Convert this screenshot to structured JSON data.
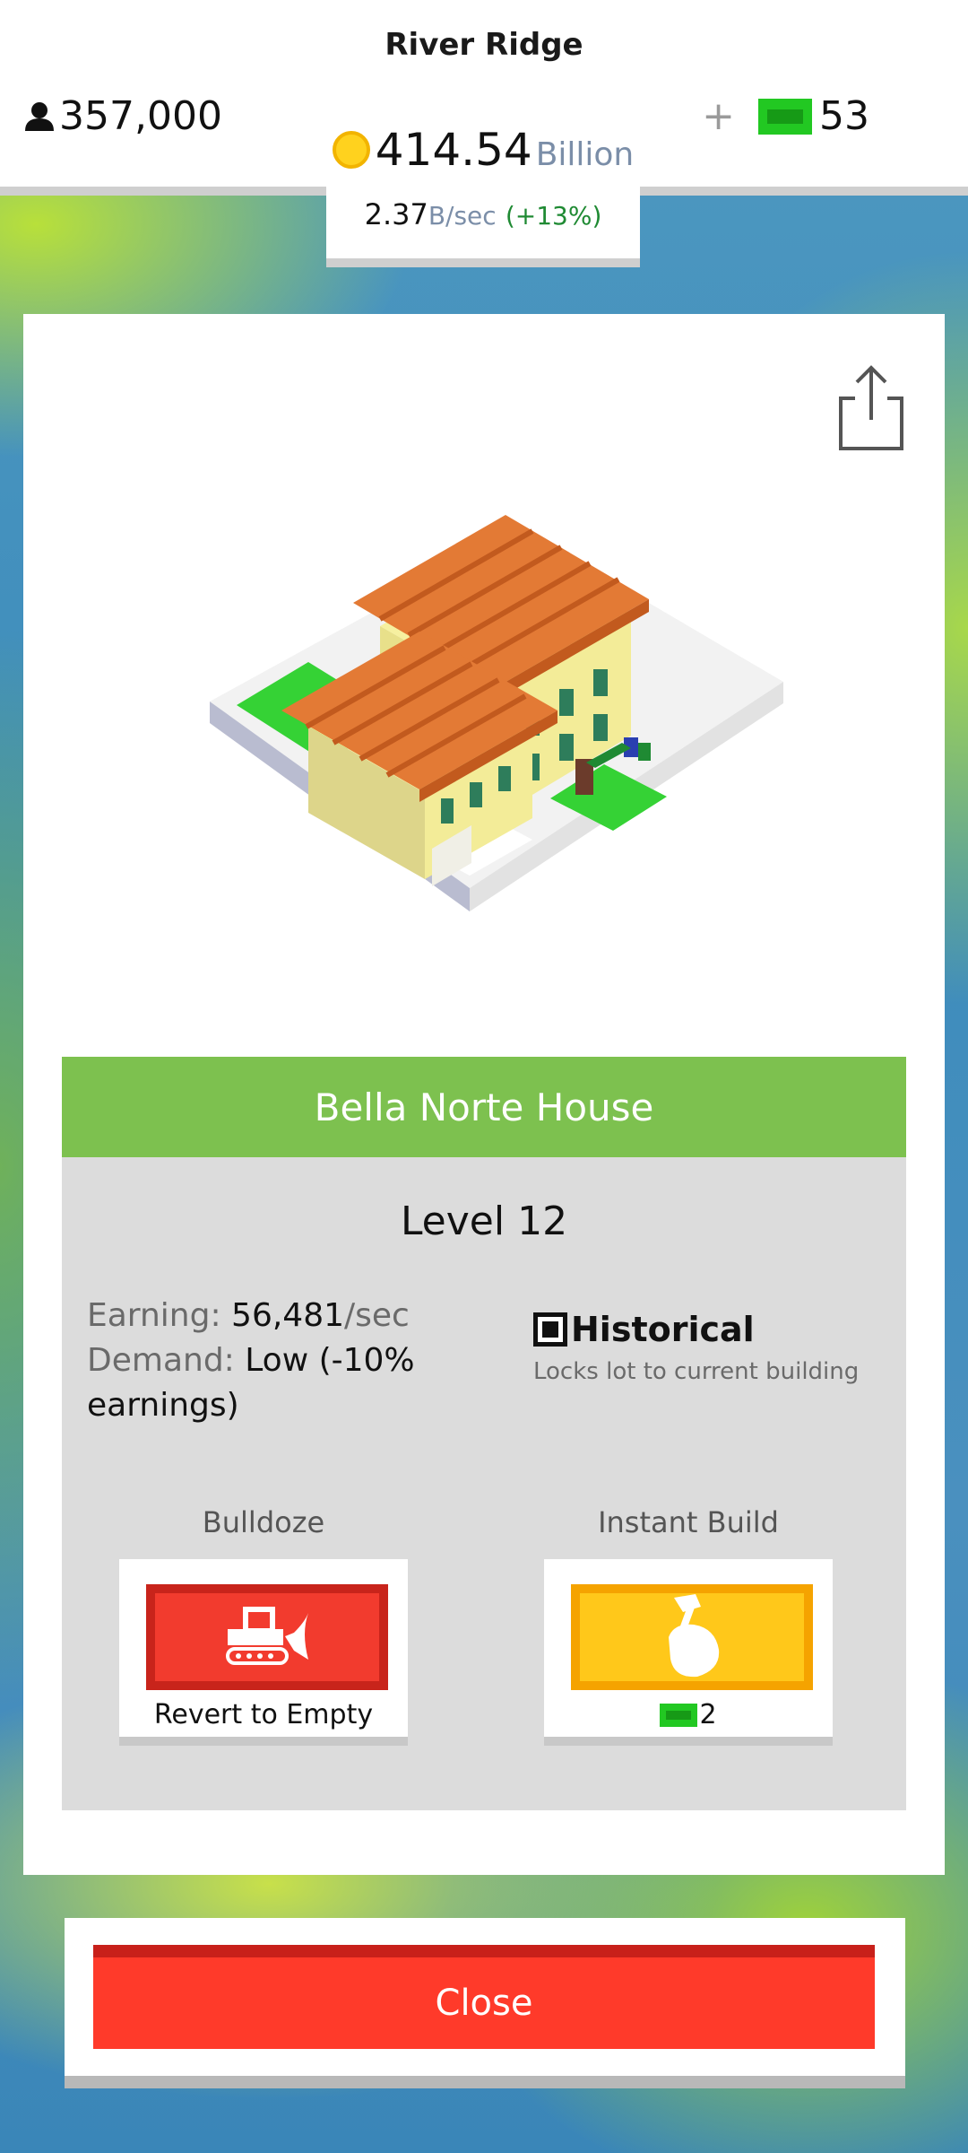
{
  "header": {
    "city_name": "River Ridge",
    "population": "357,000",
    "money_value": "414.54",
    "money_unit": "Billion",
    "rate_value": "2.37",
    "rate_unit": "B/sec",
    "rate_change": "(+13%)",
    "gems_plus": "+",
    "gems_count": "53"
  },
  "building": {
    "name": "Bella Norte House",
    "level": "Level 12",
    "earning_label": "Earning:",
    "earning_value": "56,481",
    "earning_unit": "/sec",
    "demand_label": "Demand:",
    "demand_value": "Low (-10% earnings)",
    "historical_label": "Historical",
    "historical_desc": "Locks lot to current building"
  },
  "actions": {
    "bulldoze_title": "Bulldoze",
    "bulldoze_sub": "Revert to Empty",
    "instant_title": "Instant Build",
    "instant_cost": "2"
  },
  "footer": {
    "close_label": "Close"
  },
  "colors": {
    "name_bar": "#7dc14f",
    "close": "#ff3a2a",
    "bulldoze": "#f23b2e",
    "instant": "#ffc81a",
    "cash": "#22c822"
  },
  "icons": [
    "person-icon",
    "coin-icon",
    "cash-icon",
    "share-icon",
    "checkbox-icon",
    "bulldozer-icon",
    "hammer-hand-icon"
  ]
}
